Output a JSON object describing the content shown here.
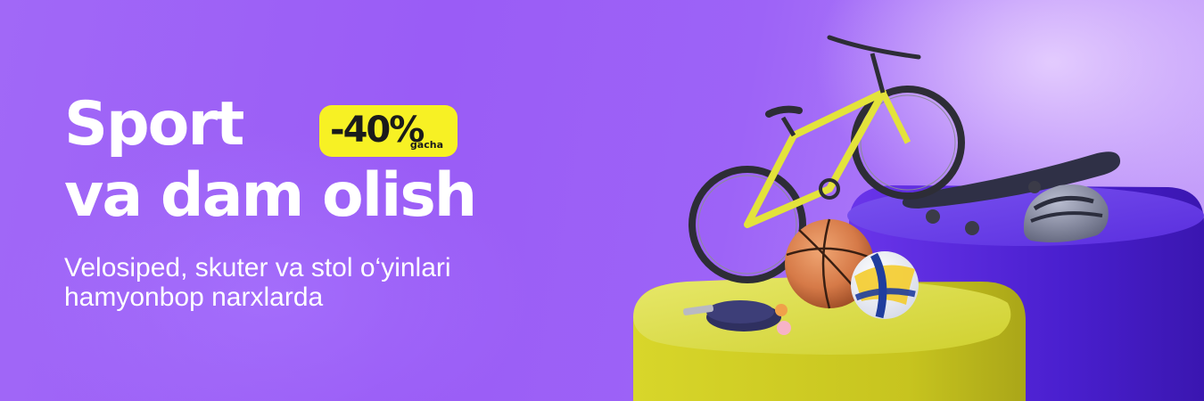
{
  "banner": {
    "title_line1": "Sport",
    "title_line2": "va dam olish",
    "badge": {
      "value": "-40%",
      "suffix": "gacha"
    },
    "subtitle_line1": "Velosiped, skuter va stol o‘yinlari",
    "subtitle_line2": "hamyonbop narxlarda"
  },
  "colors": {
    "background": "#9d63f7",
    "badge": "#f7f124",
    "text": "#ffffff",
    "yellow_pedestal": "#d6d62a",
    "purple_pedestal": "#5f33e0"
  },
  "illustration": {
    "items": [
      "bicycle",
      "basketball",
      "volleyball",
      "skateboard",
      "helmet",
      "ping-pong-paddles",
      "ping-pong-balls",
      "pedestals"
    ]
  }
}
